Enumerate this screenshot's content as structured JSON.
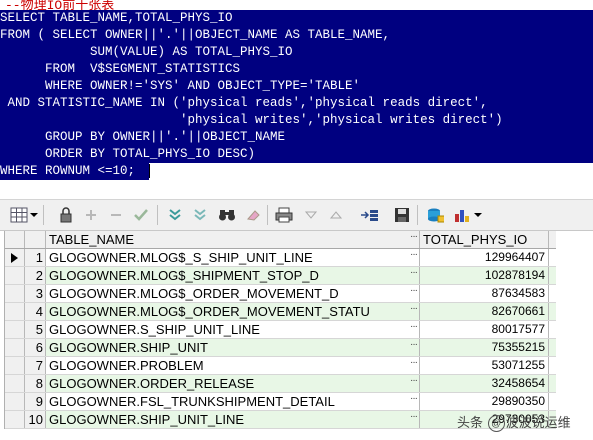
{
  "editor": {
    "comment": "--物理IO前十张表",
    "lines": [
      "SELECT TABLE_NAME,TOTAL_PHYS_IO",
      "FROM ( SELECT OWNER||'.'||OBJECT_NAME AS TABLE_NAME,",
      "            SUM(VALUE) AS TOTAL_PHYS_IO",
      "      FROM  V$SEGMENT_STATISTICS",
      "      WHERE OWNER!='SYS' AND OBJECT_TYPE='TABLE'",
      " AND STATISTIC_NAME IN ('physical reads','physical reads direct',",
      "                        'physical writes','physical writes direct')",
      "      GROUP BY OWNER||'.'||OBJECT_NAME",
      "      ORDER BY TOTAL_PHYS_IO DESC)",
      "WHERE ROWNUM <=10;"
    ]
  },
  "grid": {
    "headers": {
      "name": "TABLE_NAME",
      "value": "TOTAL_PHYS_IO"
    },
    "ellipsis": "···",
    "rows": [
      {
        "num": "1",
        "name": "GLOGOWNER.MLOG$_S_SHIP_UNIT_LINE",
        "value": "129964407"
      },
      {
        "num": "2",
        "name": "GLOGOWNER.MLOG$_SHIPMENT_STOP_D",
        "value": "102878194"
      },
      {
        "num": "3",
        "name": "GLOGOWNER.MLOG$_ORDER_MOVEMENT_D",
        "value": "87634583"
      },
      {
        "num": "4",
        "name": "GLOGOWNER.MLOG$_ORDER_MOVEMENT_STATU",
        "value": "82670661"
      },
      {
        "num": "5",
        "name": "GLOGOWNER.S_SHIP_UNIT_LINE",
        "value": "80017577"
      },
      {
        "num": "6",
        "name": "GLOGOWNER.SHIP_UNIT",
        "value": "75355215"
      },
      {
        "num": "7",
        "name": "GLOGOWNER.PROBLEM",
        "value": "53071255"
      },
      {
        "num": "8",
        "name": "GLOGOWNER.ORDER_RELEASE",
        "value": "32458654"
      },
      {
        "num": "9",
        "name": "GLOGOWNER.FSL_TRUNKSHIPMENT_DETAIL",
        "value": "29890350"
      },
      {
        "num": "10",
        "name": "GLOGOWNER.SHIP_UNIT_LINE",
        "value": "29730053"
      }
    ]
  },
  "watermark": {
    "prefix": "头条",
    "at": "@",
    "name": "波波说运维"
  },
  "colors": {
    "selection": "#000080",
    "alt_row": "#e8f7e6",
    "comment": "#cc0000"
  },
  "icons": [
    "grid-icon",
    "lock-icon",
    "plus-icon",
    "minus-icon",
    "check-icon",
    "filter-down-icon",
    "filter-clear-icon",
    "binoculars-icon",
    "eraser-icon",
    "print-icon",
    "dropdown-icon",
    "up-icon",
    "export-icon",
    "save-icon",
    "query-icon",
    "chart-icon"
  ]
}
